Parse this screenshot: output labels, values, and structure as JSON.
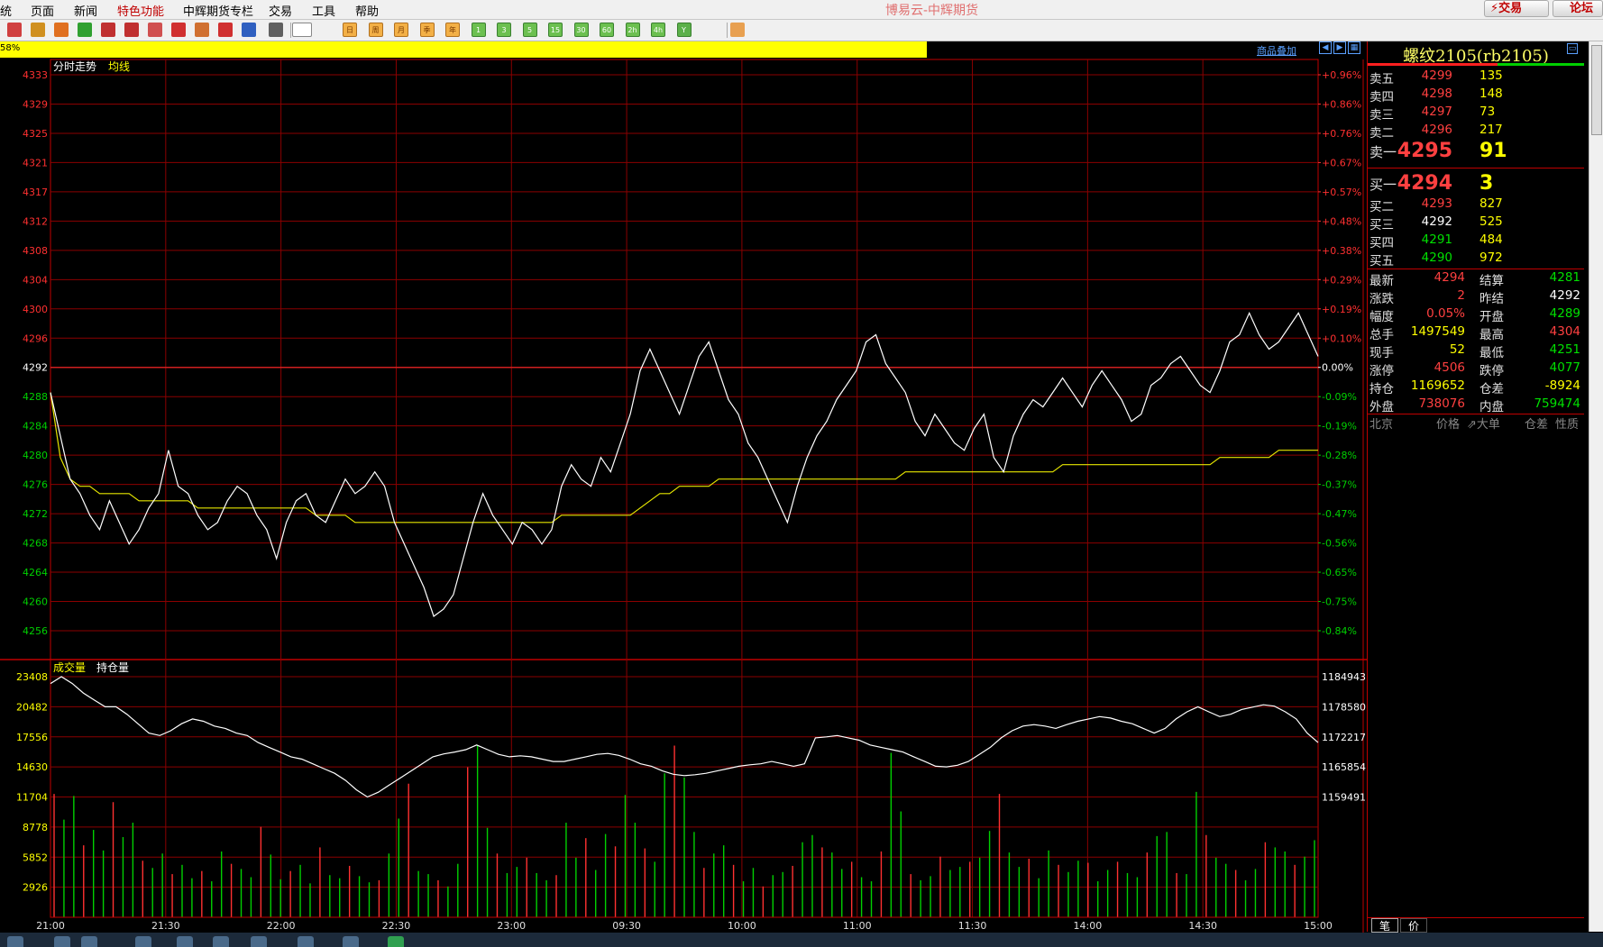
{
  "menu": {
    "items": [
      "统",
      "页面",
      "新闻",
      "特色功能",
      "中辉期货专栏",
      "交易",
      "工具",
      "帮助"
    ],
    "highlight_index": 3,
    "app_title": "博易云-中辉期货",
    "trade_button": "⚡交易",
    "forum_button": "论坛"
  },
  "toolbar": {
    "icons": [
      "home-icon",
      "tablet-icon",
      "f10-icon",
      "refresh-icon",
      "zoom-in-icon",
      "zoom-out-icon",
      "window-icon",
      "pen-icon",
      "shape-icon",
      "filter-icon",
      "star-icon",
      "list-icon",
      "line-chart-icon",
      "kline-icon",
      "day-period",
      "week-period",
      "month-period",
      "season-period",
      "year-period",
      "1min-period",
      "3min-period",
      "5min-period",
      "15min-period",
      "30min-period",
      "60min-period",
      "2h-period",
      "4h-period",
      "custom-period",
      "calculator-icon"
    ],
    "period_labels": [
      "日",
      "周",
      "月",
      "季",
      "年",
      "1",
      "3",
      "5",
      "15",
      "30",
      "60",
      "2h",
      "4h",
      "Y"
    ]
  },
  "status": {
    "percent_text": "58%",
    "overlay_link": "商品叠加",
    "accent": "#ffff00"
  },
  "chart_data": [
    {
      "type": "line",
      "title": "分时走势",
      "legend": [
        "分时走势",
        "均线"
      ],
      "x_ticks": [
        "21:00",
        "21:30",
        "22:00",
        "22:30",
        "23:00",
        "09:30",
        "10:00",
        "11:00",
        "11:30",
        "14:00",
        "14:30",
        "15:00"
      ],
      "y_ticks": [
        4333,
        4329,
        4325,
        4321,
        4317,
        4312,
        4308,
        4304,
        4300,
        4296,
        4292,
        4288,
        4284,
        4280,
        4276,
        4272,
        4268,
        4264,
        4260,
        4256
      ],
      "pct_ticks": [
        "+0.96%",
        "+0.86%",
        "+0.76%",
        "+0.67%",
        "+0.57%",
        "+0.48%",
        "+0.38%",
        "+0.29%",
        "+0.19%",
        "+0.10%",
        "0.00%",
        "-0.09%",
        "-0.19%",
        "-0.28%",
        "-0.37%",
        "-0.47%",
        "-0.56%",
        "-0.65%",
        "-0.75%",
        "-0.84%"
      ],
      "ylim": [
        4256,
        4333
      ],
      "prev_settle": 4292,
      "series": [
        {
          "name": "分时走势",
          "color": "#ffffff",
          "values": [
            4289,
            4283,
            4277,
            4275,
            4272,
            4270,
            4274,
            4271,
            4268,
            4270,
            4273,
            4275,
            4281,
            4276,
            4275,
            4272,
            4270,
            4271,
            4274,
            4276,
            4275,
            4272,
            4270,
            4266,
            4271,
            4274,
            4275,
            4272,
            4271,
            4274,
            4277,
            4275,
            4276,
            4278,
            4276,
            4271,
            4268,
            4265,
            4262,
            4258,
            4259,
            4261,
            4266,
            4271,
            4275,
            4272,
            4270,
            4268,
            4271,
            4270,
            4268,
            4270,
            4276,
            4279,
            4277,
            4276,
            4280,
            4278,
            4282,
            4286,
            4292,
            4295,
            4292,
            4289,
            4286,
            4290,
            4294,
            4296,
            4292,
            4288,
            4286,
            4282,
            4280,
            4277,
            4274,
            4271,
            4276,
            4280,
            4283,
            4285,
            4288,
            4290,
            4292,
            4296,
            4297,
            4293,
            4291,
            4289,
            4285,
            4283,
            4286,
            4284,
            4282,
            4281,
            4284,
            4286,
            4280,
            4278,
            4283,
            4286,
            4288,
            4287,
            4289,
            4291,
            4289,
            4287,
            4290,
            4292,
            4290,
            4288,
            4285,
            4286,
            4290,
            4291,
            4293,
            4294,
            4292,
            4290,
            4289,
            4292,
            4296,
            4297,
            4300,
            4297,
            4295,
            4296,
            4298,
            4300,
            4297,
            4294
          ]
        },
        {
          "name": "均线",
          "color": "#e6e600",
          "values": [
            4289,
            4280,
            4277,
            4276,
            4276,
            4275,
            4275,
            4275,
            4275,
            4274,
            4274,
            4274,
            4274,
            4274,
            4274,
            4273,
            4273,
            4273,
            4273,
            4273,
            4273,
            4273,
            4273,
            4273,
            4273,
            4273,
            4273,
            4272,
            4272,
            4272,
            4272,
            4271,
            4271,
            4271,
            4271,
            4271,
            4271,
            4271,
            4271,
            4271,
            4271,
            4271,
            4271,
            4271,
            4271,
            4271,
            4271,
            4271,
            4271,
            4271,
            4271,
            4271,
            4272,
            4272,
            4272,
            4272,
            4272,
            4272,
            4272,
            4272,
            4273,
            4274,
            4275,
            4275,
            4276,
            4276,
            4276,
            4276,
            4277,
            4277,
            4277,
            4277,
            4277,
            4277,
            4277,
            4277,
            4277,
            4277,
            4277,
            4277,
            4277,
            4277,
            4277,
            4277,
            4277,
            4277,
            4277,
            4278,
            4278,
            4278,
            4278,
            4278,
            4278,
            4278,
            4278,
            4278,
            4278,
            4278,
            4278,
            4278,
            4278,
            4278,
            4278,
            4279,
            4279,
            4279,
            4279,
            4279,
            4279,
            4279,
            4279,
            4279,
            4279,
            4279,
            4279,
            4279,
            4279,
            4279,
            4279,
            4280,
            4280,
            4280,
            4280,
            4280,
            4280,
            4281,
            4281,
            4281,
            4281,
            4281
          ]
        }
      ]
    },
    {
      "type": "bar",
      "title": "成交量",
      "legend": [
        "成交量",
        "持仓量"
      ],
      "y_ticks": [
        23408,
        20482,
        17556,
        14630,
        11704,
        8778,
        5852,
        2926
      ],
      "y2_ticks": [
        1184943,
        1178580,
        1172217,
        1165854,
        1159491
      ],
      "series": [
        {
          "name": "成交量",
          "colors": [
            "#ff3030",
            "#00d000"
          ],
          "values": [
            12000,
            9500,
            11800,
            7000,
            8500,
            6500,
            11200,
            7800,
            9200,
            5500,
            4800,
            6200,
            4200,
            5100,
            3800,
            4500,
            3500,
            6400,
            5200,
            4700,
            3900,
            8800,
            6100,
            3700,
            4500,
            5100,
            3300,
            6800,
            4100,
            3800,
            5000,
            4000,
            3400,
            3600,
            6200,
            9600,
            13000,
            4500,
            4200,
            3600,
            3000,
            5200,
            14600,
            16700,
            8700,
            6200,
            4300,
            4900,
            5800,
            4300,
            3600,
            4100,
            9200,
            5800,
            7700,
            4600,
            8100,
            6900,
            11900,
            9200,
            6700,
            5400,
            14000,
            16700,
            13600,
            8300,
            4800,
            6200,
            7000,
            5100,
            3500,
            4800,
            3000,
            4100,
            4400,
            5000,
            7300,
            8000,
            6800,
            6300,
            4700,
            5400,
            3900,
            3500,
            6400,
            16000,
            10300,
            4200,
            3600,
            4000,
            5900,
            4600,
            4900,
            5400,
            5800,
            8400,
            12000,
            6300,
            4900,
            5700,
            3800,
            6500,
            5100,
            4400,
            5500,
            5300,
            3500,
            4600,
            5400,
            4300,
            3900,
            6300,
            7900,
            8300,
            4300,
            4200,
            12200,
            8000,
            5800,
            5200,
            4600,
            3600,
            4700,
            7300,
            6800,
            6400,
            5100,
            5900,
            7500
          ]
        },
        {
          "name": "持仓量",
          "color": "#ffffff",
          "values": [
            1183500,
            1184943,
            1183500,
            1181500,
            1180000,
            1178580,
            1178580,
            1177000,
            1175000,
            1173000,
            1172500,
            1173500,
            1175000,
            1176000,
            1175500,
            1174500,
            1174000,
            1173000,
            1172500,
            1171000,
            1170000,
            1169000,
            1168000,
            1167500,
            1166500,
            1165500,
            1164500,
            1163000,
            1161000,
            1159491,
            1160500,
            1162000,
            1163500,
            1165000,
            1166500,
            1168000,
            1168600,
            1169000,
            1169500,
            1170500,
            1169500,
            1168500,
            1168000,
            1168200,
            1168000,
            1167500,
            1167000,
            1167000,
            1167500,
            1168000,
            1168500,
            1168700,
            1168300,
            1167500,
            1166500,
            1166000,
            1165000,
            1164300,
            1164000,
            1164200,
            1164500,
            1165000,
            1165500,
            1166000,
            1166300,
            1166500,
            1167000,
            1166500,
            1166000,
            1166500,
            1172000,
            1172217,
            1172500,
            1172000,
            1171500,
            1170500,
            1170000,
            1169500,
            1169000,
            1168000,
            1167000,
            1166000,
            1165854,
            1166200,
            1167000,
            1168500,
            1170000,
            1172000,
            1173500,
            1174500,
            1174800,
            1174500,
            1174000,
            1174800,
            1175500,
            1176000,
            1176500,
            1176200,
            1175500,
            1175000,
            1174000,
            1173000,
            1174000,
            1176000,
            1177500,
            1178580,
            1177500,
            1176500,
            1177000,
            1178000,
            1178500,
            1179000,
            1178700,
            1177500,
            1176000,
            1173000,
            1171000
          ]
        }
      ]
    }
  ],
  "quote": {
    "symbol": "螺纹2105(rb2105)",
    "asks": [
      {
        "label": "卖五",
        "price": "4299",
        "vol": "135"
      },
      {
        "label": "卖四",
        "price": "4298",
        "vol": "148"
      },
      {
        "label": "卖三",
        "price": "4297",
        "vol": "73"
      },
      {
        "label": "卖二",
        "price": "4296",
        "vol": "217"
      }
    ],
    "ask1": {
      "label": "卖一",
      "price": "4295",
      "vol": "91"
    },
    "bid1": {
      "label": "买一",
      "price": "4294",
      "vol": "3"
    },
    "bids": [
      {
        "label": "买二",
        "price": "4293",
        "vol": "827"
      },
      {
        "label": "买三",
        "price": "4292",
        "vol": "525"
      },
      {
        "label": "买四",
        "price": "4291",
        "vol": "484"
      },
      {
        "label": "买五",
        "price": "4290",
        "vol": "972"
      }
    ],
    "stats": [
      {
        "l1": "最新",
        "v1": "4294",
        "c1": "red",
        "l2": "结算",
        "v2": "4281",
        "c2": "green"
      },
      {
        "l1": "涨跌",
        "v1": "2",
        "c1": "red",
        "l2": "昨结",
        "v2": "4292",
        "c2": "white"
      },
      {
        "l1": "幅度",
        "v1": "0.05%",
        "c1": "red",
        "l2": "开盘",
        "v2": "4289",
        "c2": "green"
      },
      {
        "l1": "总手",
        "v1": "1497549",
        "c1": "yellow",
        "l2": "最高",
        "v2": "4304",
        "c2": "red"
      },
      {
        "l1": "现手",
        "v1": "52",
        "c1": "yellow",
        "l2": "最低",
        "v2": "4251",
        "c2": "green"
      },
      {
        "l1": "涨停",
        "v1": "4506",
        "c1": "red",
        "l2": "跌停",
        "v2": "4077",
        "c2": "green"
      },
      {
        "l1": "持仓",
        "v1": "1169652",
        "c1": "yellow",
        "l2": "仓差",
        "v2": "-8924",
        "c2": "yellow"
      },
      {
        "l1": "外盘",
        "v1": "738076",
        "c1": "red",
        "l2": "内盘",
        "v2": "759474",
        "c2": "green"
      }
    ],
    "ticks_header": [
      "北京",
      "价格",
      "⇗大单",
      "仓差",
      "性质"
    ],
    "tabs": [
      "笔",
      "价"
    ]
  }
}
